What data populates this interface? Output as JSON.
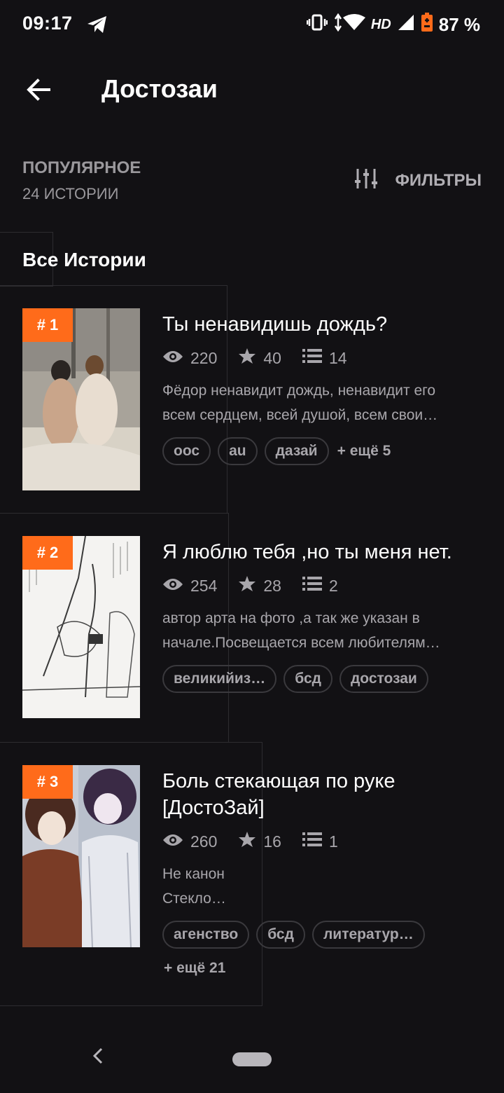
{
  "status_bar": {
    "time": "09:17",
    "network": "HD",
    "battery": "87 %"
  },
  "app_bar": {
    "title": "Достозаи"
  },
  "header": {
    "sort_label": "ПОПУЛЯРНОЕ",
    "count_label": "24 ИСТОРИИ",
    "filters_label": "ФИЛЬТРЫ"
  },
  "tab": {
    "label": "Все Истории"
  },
  "stories": [
    {
      "rank": "# 1",
      "title": "Ты ненавидишь  дождь?",
      "views": "220",
      "stars": "40",
      "parts": "14",
      "desc_lines": [
        "Фёдор ненавидит дождь, ненавидит его",
        "всем сердцем, всей душой, всем свои…"
      ],
      "tags": [
        "оос",
        "au",
        "дазай"
      ],
      "more": "+ ещё 5"
    },
    {
      "rank": "# 2",
      "title": "Я люблю тебя ,но ты меня нет.",
      "views": "254",
      "stars": "28",
      "parts": "2",
      "desc_lines": [
        "автор арта на фото ,а так же указан в",
        "начале.Посвещается всем любителям…"
      ],
      "tags": [
        "великийиз…",
        "бсд",
        "достозаи"
      ],
      "more": ""
    },
    {
      "rank": "# 3",
      "title": "Боль стекающая по руке [ДостоЗай]",
      "views": "260",
      "stars": "16",
      "parts": "1",
      "desc_lines": [
        "Не канон",
        "Стекло…"
      ],
      "tags": [
        "агенство",
        "бсд",
        "литератур…"
      ],
      "more": "+ ещё 21"
    }
  ],
  "colors": {
    "background": "#121114",
    "accent": "#ff6b1a",
    "muted_text": "#a8a6ab"
  },
  "icons": [
    "telegram-icon",
    "vibrate-icon",
    "wifi-icon",
    "signal-icon",
    "battery-icon",
    "back-arrow-icon",
    "filter-sliders-icon",
    "eye-icon",
    "star-icon",
    "list-icon",
    "nav-back-icon"
  ]
}
